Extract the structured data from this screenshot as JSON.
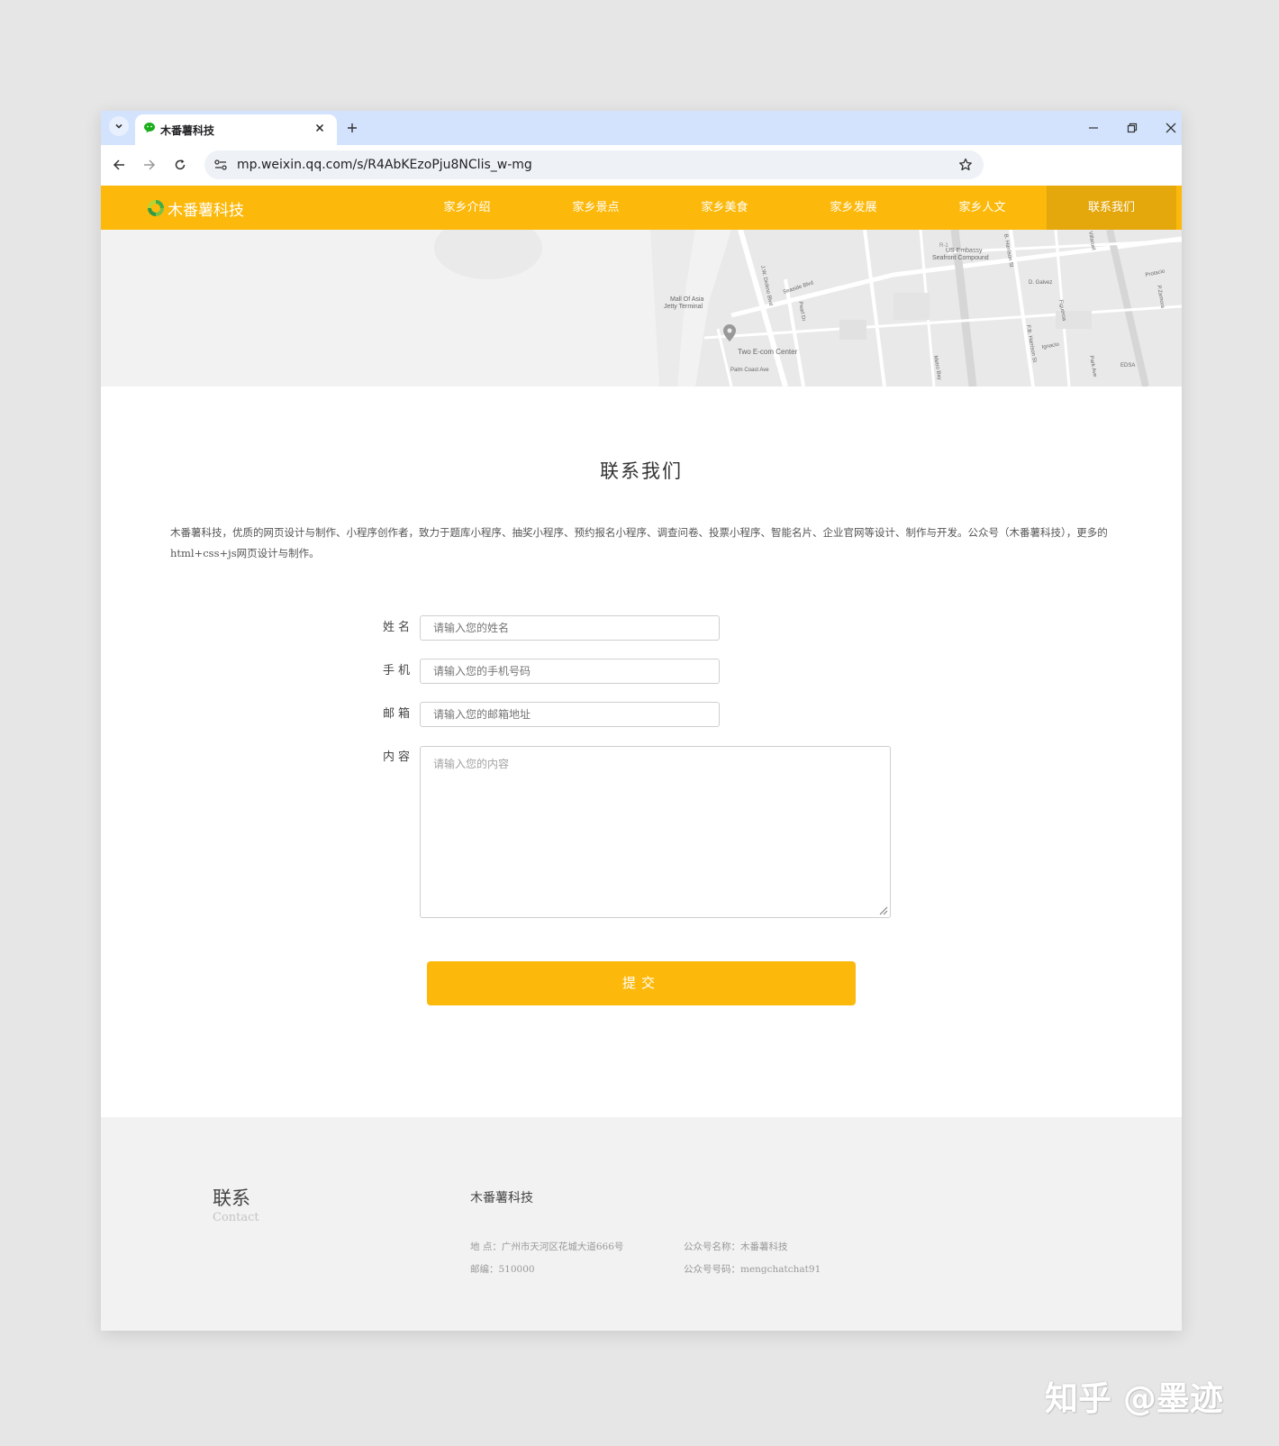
{
  "browser": {
    "tab_title": "木番薯科技",
    "url": "mp.weixin.qq.com/s/R4AbKEzoPju8NClis_w-mg"
  },
  "site": {
    "logo_text": "木番薯科技",
    "nav": [
      {
        "label": "家乡介绍"
      },
      {
        "label": "家乡景点"
      },
      {
        "label": "家乡美食"
      },
      {
        "label": "家乡发展"
      },
      {
        "label": "家乡人文"
      },
      {
        "label": "联系我们"
      }
    ],
    "map_labels": {
      "embassy": "US Embassy",
      "seafront": "Seafront Compound",
      "mall": "Mall Of Asia",
      "jetty": "Jetty Terminal",
      "center": "Two E-com Center",
      "palm": "Palm Coast Ave",
      "seaside": "Seaside Blvd",
      "diokno": "J.W. Diokno Blvd",
      "pearl": "Pearl Dr",
      "harrison": "B. Harrison St",
      "fb_harrison": "F.B. Harrison St",
      "galvez": "D. Galvez",
      "figueroa": "Figueroa",
      "ignacio": "Ignacio",
      "edsa": "EDSA",
      "park": "Park Ave",
      "metro": "Metro Bay",
      "protacio": "Protacio",
      "zamora": "P.Zamora",
      "villaruel": "Villaruel",
      "route": "R-1"
    }
  },
  "contact": {
    "title": "联系我们",
    "intro": "木番薯科技，优质的网页设计与制作、小程序创作者，致力于题库小程序、抽奖小程序、预约报名小程序、调查问卷、投票小程序、智能名片、企业官网等设计、制作与开发。公众号（木番薯科技），更多的html+css+js网页设计与制作。",
    "form": {
      "name_label": "姓名",
      "name_placeholder": "请输入您的姓名",
      "phone_label": "手机",
      "phone_placeholder": "请输入您的手机号码",
      "email_label": "邮箱",
      "email_placeholder": "请输入您的邮箱地址",
      "content_label": "内容",
      "content_placeholder": "请输入您的内容",
      "submit_label": "提交"
    }
  },
  "footer": {
    "title": "联系",
    "subtitle": "Contact",
    "company": "木番薯科技",
    "address": "地 点：广州市天河区花城大道666号",
    "postcode": "邮编：510000",
    "account_name": "公众号名称：木番薯科技",
    "account_id": "公众号号码：mengchatchat91"
  },
  "watermark": "知乎 @墨迹",
  "colors": {
    "accent": "#fcb90b",
    "nav_active": "#e4a80c",
    "tab_strip": "#d3e3fd"
  }
}
